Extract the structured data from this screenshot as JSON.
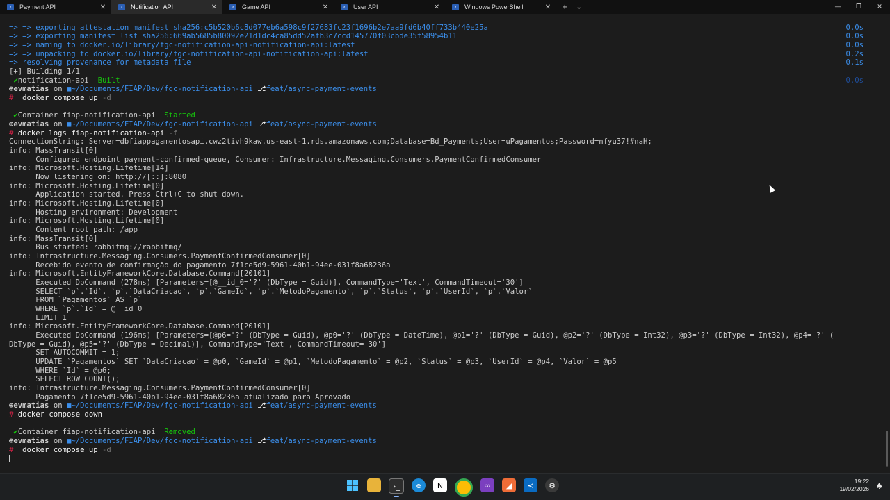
{
  "tabs": [
    {
      "label": "Payment API",
      "active": false
    },
    {
      "label": "Notification API",
      "active": true
    },
    {
      "label": "Game API",
      "active": false
    },
    {
      "label": "User API",
      "active": false
    },
    {
      "label": "Windows PowerShell",
      "active": false
    }
  ],
  "tab_actions": {
    "new_tab": "+",
    "dropdown": "⌄"
  },
  "window_controls": {
    "minimize": "—",
    "maximize": "❐",
    "close": "✕"
  },
  "terminal": {
    "l01": "=> => exporting attestation manifest sha256:c5b520b6c8d077eb6a598c9f27683fc23f1696b2e7aa9fd6b40ff733b440e25a",
    "t01": "0.0s",
    "l02": "=> => exporting manifest list sha256:669ab5685b80092e21d1dc4ca85dd52afb3c7ccd145770f03cbde35f58954b11",
    "t02": "0.0s",
    "l03": "=> => naming to docker.io/library/fgc-notification-api-notification-api:latest",
    "t03": "0.0s",
    "l04": "=> => unpacking to docker.io/library/fgc-notification-api-notification-api:latest",
    "t04": "0.2s",
    "l05": "=> resolving provenance for metadata file",
    "t05": "0.1s",
    "l06": "[+] Building 1/1",
    "l07_name": "notification-api",
    "l07_status": "Built",
    "prompt_user": "evmatias",
    "prompt_on": "on",
    "prompt_path": "~/Documents/FIAP/Dev/fgc-notification-api",
    "prompt_branch": "feat/async-payment-events",
    "cmd1": "docker compose up",
    "cmd1_flag": "-d",
    "l10_name": "Container fiap-notification-api",
    "l10_status": "Started",
    "cmd2": "docker logs fiap-notification-api",
    "cmd2_flag": "-f",
    "l13": "ConnectionString: Server=dbfiappagamentosapi.cwz2tivh9kaw.us-east-1.rds.amazonaws.com;Database=Bd_Payments;User=uPagamentos;Password=nfyu37!#naH;",
    "l14": "info: MassTransit[0]",
    "l15": "      Configured endpoint payment-confirmed-queue, Consumer: Infrastructure.Messaging.Consumers.PaymentConfirmedConsumer",
    "l16": "info: Microsoft.Hosting.Lifetime[14]",
    "l17": "      Now listening on: http://[::]:8080",
    "l18": "info: Microsoft.Hosting.Lifetime[0]",
    "l19": "      Application started. Press Ctrl+C to shut down.",
    "l20": "info: Microsoft.Hosting.Lifetime[0]",
    "l21": "      Hosting environment: Development",
    "l22": "info: Microsoft.Hosting.Lifetime[0]",
    "l23": "      Content root path: /app",
    "l24": "info: MassTransit[0]",
    "l25": "      Bus started: rabbitmq://rabbitmq/",
    "l26": "info: Infrastructure.Messaging.Consumers.PaymentConfirmedConsumer[0]",
    "l27": "      Recebido evento de confirmação do pagamento 7f1ce5d9-5961-40b1-94ee-031f8a68236a",
    "l28": "info: Microsoft.EntityFrameworkCore.Database.Command[20101]",
    "l29": "      Executed DbCommand (278ms) [Parameters=[@__id_0='?' (DbType = Guid)], CommandType='Text', CommandTimeout='30']",
    "l30": "      SELECT `p`.`Id`, `p`.`DataCriacao`, `p`.`GameId`, `p`.`MetodoPagamento`, `p`.`Status`, `p`.`UserId`, `p`.`Valor`",
    "l31": "      FROM `Pagamentos` AS `p`",
    "l32": "      WHERE `p`.`Id` = @__id_0",
    "l33": "      LIMIT 1",
    "l34": "info: Microsoft.EntityFrameworkCore.Database.Command[20101]",
    "l35": "      Executed DbCommand (196ms) [Parameters=[@p6='?' (DbType = Guid), @p0='?' (DbType = DateTime), @p1='?' (DbType = Guid), @p2='?' (DbType = Int32), @p3='?' (DbType = Int32), @p4='?' (",
    "l36": "DbType = Guid), @p5='?' (DbType = Decimal)], CommandType='Text', CommandTimeout='30']",
    "l37": "      SET AUTOCOMMIT = 1;",
    "l38": "      UPDATE `Pagamentos` SET `DataCriacao` = @p0, `GameId` = @p1, `MetodoPagamento` = @p2, `Status` = @p3, `UserId` = @p4, `Valor` = @p5",
    "l39": "      WHERE `Id` = @p6;",
    "l40": "      SELECT ROW_COUNT();",
    "l41": "info: Infrastructure.Messaging.Consumers.PaymentConfirmedConsumer[0]",
    "l42": "      Pagamento 7f1ce5d9-5961-40b1-94ee-031f8a68236a atualizado para Aprovado",
    "cmd3": "docker compose down",
    "l45_name": "Container fiap-notification-api",
    "l45_status": "Removed",
    "cmd4": "docker compose up",
    "cmd4_flag": "-d"
  },
  "taskbar": {
    "time": "19:22",
    "date": "19/02/2026"
  },
  "colors": {
    "background": "#1c1c1c",
    "blue": "#3b8eea",
    "green": "#16c60c",
    "accent": "#8ab4f8"
  }
}
